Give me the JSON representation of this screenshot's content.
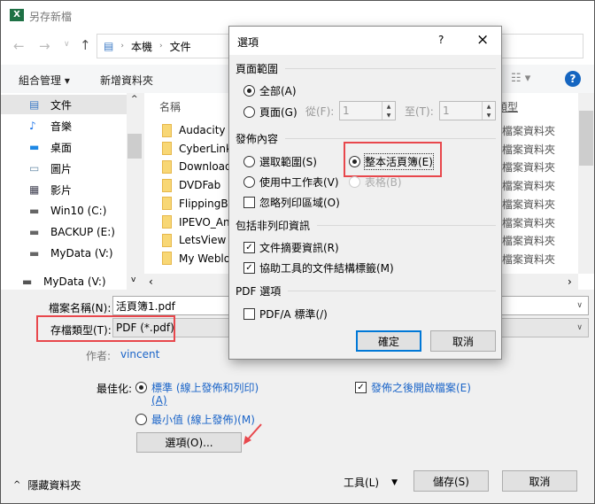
{
  "window": {
    "title": "另存新檔",
    "app_icon": "excel-icon"
  },
  "address": {
    "crumbs": [
      "本機",
      "文件"
    ]
  },
  "toolbar": {
    "organize": "組合管理",
    "new_folder": "新增資料夾"
  },
  "nav": [
    {
      "label": "文件",
      "icon": "document-icon",
      "selected": true
    },
    {
      "label": "音樂",
      "icon": "music-icon"
    },
    {
      "label": "桌面",
      "icon": "desktop-icon"
    },
    {
      "label": "圖片",
      "icon": "pictures-icon"
    },
    {
      "label": "影片",
      "icon": "videos-icon"
    },
    {
      "label": "Win10 (C:)",
      "icon": "drive-icon"
    },
    {
      "label": "BACKUP (E:)",
      "icon": "drive-icon"
    },
    {
      "label": "MyData (V:)",
      "icon": "drive-icon"
    },
    {
      "label": "MyData (V:)",
      "icon": "network-drive-icon"
    }
  ],
  "list": {
    "col_name": "名稱",
    "col_type": "類型",
    "rows": [
      {
        "name": "Audacity",
        "type": "檔案資料夾"
      },
      {
        "name": "CyberLink",
        "type": "檔案資料夾"
      },
      {
        "name": "Download",
        "type": "檔案資料夾"
      },
      {
        "name": "DVDFab",
        "type": "檔案資料夾"
      },
      {
        "name": "FlippingBo",
        "type": "檔案資料夾"
      },
      {
        "name": "IPEVO_Ann",
        "type": "檔案資料夾"
      },
      {
        "name": "LetsView",
        "type": "檔案資料夾"
      },
      {
        "name": "My Weblo",
        "type": "檔案資料夾"
      }
    ]
  },
  "form": {
    "filename_label": "檔案名稱(N):",
    "filename_value": "活頁簿1.pdf",
    "filetype_label": "存檔類型(T):",
    "filetype_value": "PDF (*.pdf)",
    "author_label": "作者:",
    "author_value": "vincent",
    "optimize_label": "最佳化:",
    "opt_standard": "標準 (線上發佈和列印)",
    "opt_standard_key": "(A)",
    "opt_minimum": "最小值 (線上發佈)(M)",
    "open_after": "發佈之後開啟檔案(E)",
    "options_button": "選項(O)...",
    "hide_folders": "隱藏資料夾",
    "tools": "工具(L)",
    "save": "儲存(S)",
    "cancel": "取消"
  },
  "dialog": {
    "title": "選項",
    "help": "?",
    "close": "×",
    "page_range": "頁面範圍",
    "all": "全部(A)",
    "pages": "頁面(G)",
    "from_label": "從(F):",
    "from_value": "1",
    "to_label": "至(T):",
    "to_value": "1",
    "publish_what": "發佈內容",
    "selection": "選取範圍(S)",
    "entire_workbook": "整本活頁簿(E)",
    "active_sheets": "使用中工作表(V)",
    "table": "表格(B)",
    "ignore_print_areas": "忽略列印區域(O)",
    "include_non_printing": "包括非列印資訊",
    "doc_properties": "文件摘要資訊(R)",
    "doc_structure_tags": "協助工具的文件結構標籤(M)",
    "pdf_options": "PDF 選項",
    "pdfa": "PDF/A 標準(/)",
    "ok": "確定",
    "cancel": "取消"
  },
  "colors": {
    "accent": "#1a64c8",
    "highlight": "#e8474c",
    "selected_nav": "#e5e5e5"
  }
}
